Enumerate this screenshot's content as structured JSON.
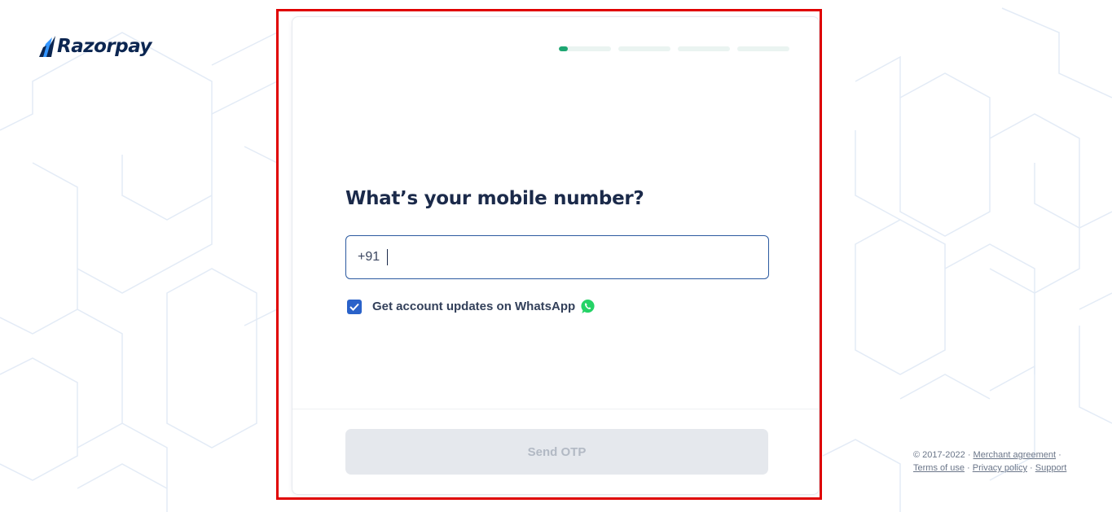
{
  "brand": {
    "name": "Razorpay",
    "color": "#0c2651",
    "accent": "#3395ff"
  },
  "progress": {
    "steps": 4,
    "current_fraction": [
      0.17,
      0,
      0,
      0
    ],
    "fill_color": "#1ea672"
  },
  "form": {
    "question": "What’s your mobile number?",
    "country_code": "+91",
    "phone_value": "",
    "whatsapp_checked": true,
    "whatsapp_label": "Get account updates on WhatsApp",
    "whatsapp_icon": "whatsapp-icon",
    "submit_label": "Send OTP"
  },
  "legal": {
    "copyright": "© 2017-2022",
    "links": [
      "Merchant agreement",
      "Terms of use",
      "Privacy policy",
      "Support"
    ]
  }
}
